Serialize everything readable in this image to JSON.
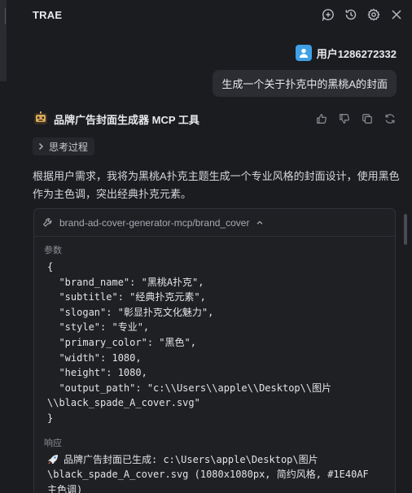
{
  "app": {
    "title": "TRAE"
  },
  "header": {
    "icons": [
      "add-chat-icon",
      "history-icon",
      "settings-icon",
      "close-icon"
    ]
  },
  "user": {
    "name": "用户1286272332",
    "message": "生成一个关于扑克中的黑桃A的封面"
  },
  "agent": {
    "name": "品牌广告封面生成器 MCP 工具",
    "thinking_label": "思考过程",
    "message": "根据用户需求，我将为黑桃A扑克主题生成一个专业风格的封面设计，使用黑色作为主色调，突出经典扑克元素。"
  },
  "tool_call": {
    "name": "brand-ad-cover-generator-mcp/brand_cover",
    "params_label": "参数",
    "params_code": "{\n  \"brand_name\": \"黑桃A扑克\",\n  \"subtitle\": \"经典扑克元素\",\n  \"slogan\": \"彰显扑克文化魅力\",\n  \"style\": \"专业\",\n  \"primary_color\": \"黑色\",\n  \"width\": 1080,\n  \"height\": 1080,\n  \"output_path\": \"c:\\\\Users\\\\apple\\\\Desktop\\\\图片\n\\\\black_spade_A_cover.svg\"\n}",
    "response_label": "响应",
    "response_line1": "品牌广告封面已生成: c:\\Users\\apple\\Desktop\\图片",
    "response_line2": "\\black_spade_A_cover.svg (1080x1080px, 简约风格, #1E40AF",
    "response_line3": "主色调)"
  },
  "colors": {
    "background": "#1b1c20",
    "avatar": "#3fa0e6"
  }
}
